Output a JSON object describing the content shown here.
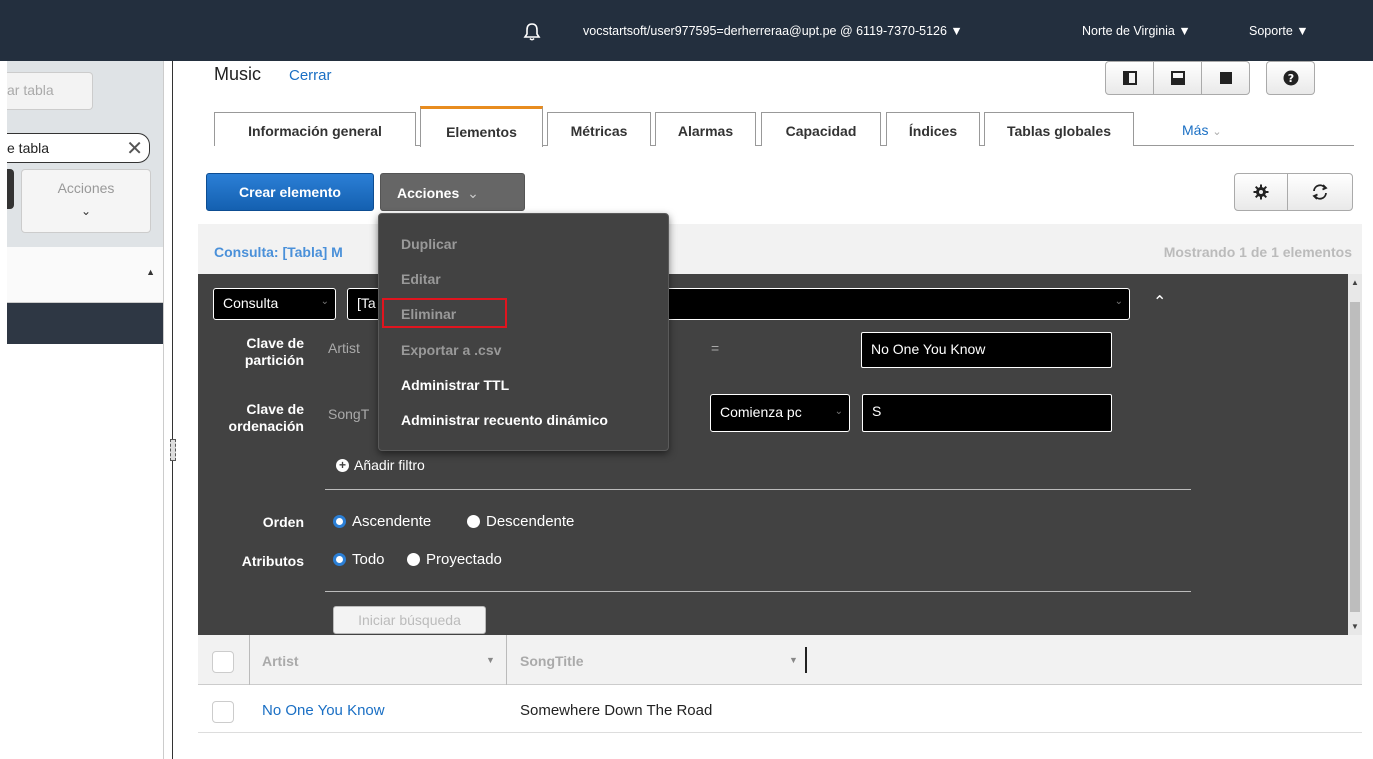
{
  "topbar": {
    "account": "vocstartsoft/user977595=derherreraa@upt.pe @ 6119-7370-5126 ▼",
    "region": "Norte de Virginia ▼",
    "support": "Soporte ▼"
  },
  "sidebar": {
    "create_table_label": "ar tabla",
    "search_value": "e tabla",
    "actions_label": "Acciones"
  },
  "table": {
    "title": "Music",
    "close": "Cerrar"
  },
  "tabs": [
    {
      "label": "Información general"
    },
    {
      "label": "Elementos"
    },
    {
      "label": "Métricas"
    },
    {
      "label": "Alarmas"
    },
    {
      "label": "Capacidad"
    },
    {
      "label": "Índices"
    },
    {
      "label": "Tablas globales"
    }
  ],
  "tab_more": "Más",
  "toolbar": {
    "create_item": "Crear elemento",
    "actions": "Acciones"
  },
  "query": {
    "title": "Consulta: [Tabla] M",
    "count": "Mostrando 1 de 1 elementos",
    "mode": "Consulta",
    "table_select": "[Ta",
    "partition_label": "Clave de partición",
    "partition_attr": "Artist",
    "partition_op": "=",
    "partition_value": "No One You Know",
    "sort_label": "Clave de ordenación",
    "sort_attr": "SongT",
    "sort_op": "Comienza pc",
    "sort_value": "S",
    "add_filter": "Añadir filtro",
    "order_label": "Orden",
    "order_asc": "Ascendente",
    "order_desc": "Descendente",
    "attrs_label": "Atributos",
    "attrs_all": "Todo",
    "attrs_projected": "Proyectado",
    "start_search": "Iniciar búsqueda"
  },
  "results": {
    "columns": [
      "Artist",
      "SongTitle"
    ],
    "rows": [
      [
        "No One You Know",
        "Somewhere Down The Road"
      ]
    ]
  },
  "actions_menu": {
    "items": [
      {
        "label": "Duplicar",
        "enabled": false
      },
      {
        "label": "Editar",
        "enabled": false
      },
      {
        "label": "Eliminar",
        "enabled": false
      },
      {
        "label": "Exportar a .csv",
        "enabled": false
      },
      {
        "label": "Administrar TTL",
        "enabled": true
      },
      {
        "label": "Administrar recuento dinámico",
        "enabled": true
      }
    ]
  },
  "colors": {
    "nav": "#232f3e",
    "primary": "#1460b0",
    "highlight": "#e0141e",
    "active_tab": "#e88c1f"
  }
}
